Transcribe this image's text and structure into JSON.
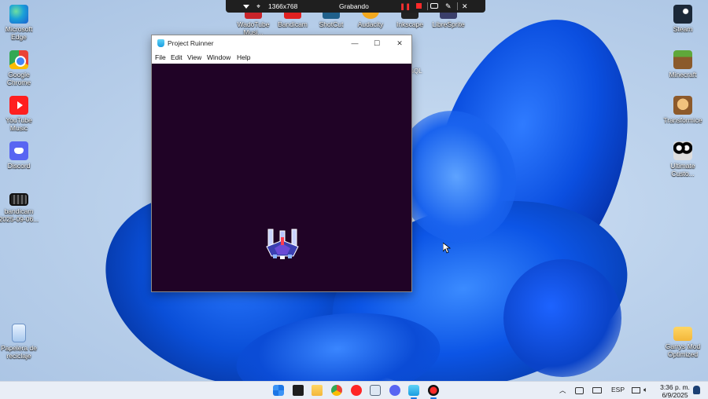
{
  "desktop": {
    "left_icons": [
      {
        "label": "Microsoft Edge",
        "icon": "edge-icon"
      },
      {
        "label": "Google Chrome",
        "icon": "chrome-icon"
      },
      {
        "label": "YouTube Music",
        "icon": "youtube-music-icon"
      },
      {
        "label": "Discord",
        "icon": "discord-icon"
      },
      {
        "label": "bandicam 2025-09-06...",
        "icon": "video-file-icon"
      },
      {
        "label": "Papelera de reciclaje",
        "icon": "recycle-bin-icon"
      }
    ],
    "right_icons": [
      {
        "label": "Steam",
        "icon": "steam-icon"
      },
      {
        "label": "Minecraft",
        "icon": "minecraft-icon"
      },
      {
        "label": "Transformice",
        "icon": "transformice-icon"
      },
      {
        "label": "Ultimate Custo...",
        "icon": "ultimate-custom-night-icon"
      },
      {
        "label": "Garrys Mod Optimized",
        "icon": "folder-icon"
      }
    ],
    "top_icons": [
      {
        "label": "WadoTube Musi..."
      },
      {
        "label": "Bandicam"
      },
      {
        "label": "ShotCut"
      },
      {
        "label": "Audacity"
      },
      {
        "label": "Inkscape"
      },
      {
        "label": "LibreSprite"
      }
    ],
    "partial_label": "sQL"
  },
  "recorder": {
    "resolution": "1366x768",
    "status": "Grabando"
  },
  "window": {
    "title": "Project Ruinner",
    "menu": [
      "File",
      "Edit",
      "View",
      "Window",
      "Help"
    ],
    "controls": {
      "minimize": "—",
      "maximize": "☐",
      "close": "✕"
    },
    "game_background": "#200326"
  },
  "taskbar": {
    "language": "ESP",
    "time": "3:36 p. m.",
    "date": "6/9/2025"
  }
}
